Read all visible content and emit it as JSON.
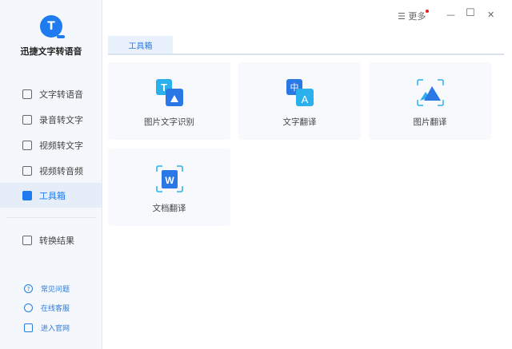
{
  "app": {
    "title": "迅捷文字转语音",
    "logo_letter": "T"
  },
  "sidebar": {
    "items": [
      {
        "label": "文字转语音",
        "icon": "text-to-speech-icon"
      },
      {
        "label": "录音转文字",
        "icon": "audio-to-text-icon"
      },
      {
        "label": "视频转文字",
        "icon": "video-to-text-icon"
      },
      {
        "label": "视频转音频",
        "icon": "video-to-audio-icon"
      },
      {
        "label": "工具箱",
        "icon": "toolbox-icon",
        "active": true
      }
    ],
    "results": "转换结果",
    "links": [
      {
        "label": "常见问题",
        "icon": "question-icon"
      },
      {
        "label": "在线客服",
        "icon": "headset-icon"
      },
      {
        "label": "进入官网",
        "icon": "monitor-icon"
      }
    ]
  },
  "header": {
    "more": "更多",
    "menu_glyph": "☰",
    "minimize": "—",
    "maximize": "☐",
    "close": "✕"
  },
  "main": {
    "tab": "工具箱",
    "tools": [
      {
        "label": "图片文字识别",
        "icon": "image-ocr-icon"
      },
      {
        "label": "文字翻译",
        "icon": "text-translate-icon"
      },
      {
        "label": "图片翻译",
        "icon": "image-translate-icon"
      },
      {
        "label": "文档翻译",
        "icon": "document-translate-icon"
      }
    ]
  },
  "colors": {
    "accent": "#1e7bf0",
    "notify": "#e02020"
  }
}
